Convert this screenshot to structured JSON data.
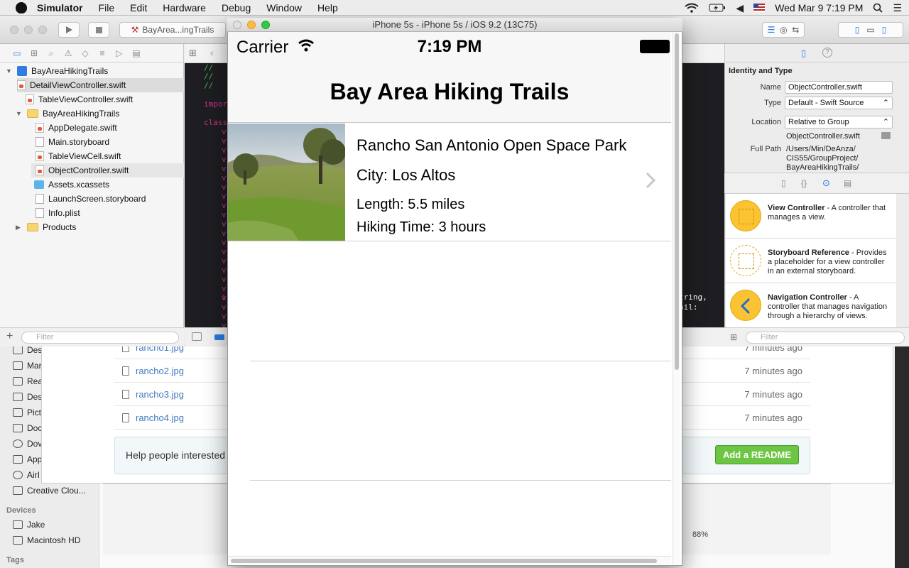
{
  "menubar": {
    "app": "Simulator",
    "items": [
      "File",
      "Edit",
      "Hardware",
      "Debug",
      "Window",
      "Help"
    ],
    "clock": "Wed Mar 9  7:19 PM"
  },
  "xcode": {
    "scheme": "BayArea...ingTrails",
    "navigator": {
      "items": [
        {
          "label": "BayAreaHikingTrails",
          "type": "project"
        },
        {
          "label": "DetailViewController.swift",
          "type": "swift"
        },
        {
          "label": "TableViewController.swift",
          "type": "swift"
        },
        {
          "label": "BayAreaHikingTrails",
          "type": "folder"
        },
        {
          "label": "AppDelegate.swift",
          "type": "swift"
        },
        {
          "label": "Main.storyboard",
          "type": "doc"
        },
        {
          "label": "TableViewCell.swift",
          "type": "swift"
        },
        {
          "label": "ObjectController.swift",
          "type": "swift"
        },
        {
          "label": "Assets.xcassets",
          "type": "assets"
        },
        {
          "label": "LaunchScreen.storyboard",
          "type": "doc"
        },
        {
          "label": "Info.plist",
          "type": "doc"
        },
        {
          "label": "Products",
          "type": "folder"
        }
      ],
      "filter_placeholder": "Filter"
    },
    "editor": {
      "c1": "//",
      "c2": "//",
      "c3": "//",
      "import": "impor",
      "class": "class",
      "i": "i",
      "right1": "tring,",
      "right2": "ail:"
    },
    "inspector": {
      "section": "Identity and Type",
      "name_label": "Name",
      "name_value": "ObjectController.swift",
      "type_label": "Type",
      "type_value": "Default - Swift Source",
      "location_label": "Location",
      "location_value": "Relative to Group",
      "location_file": "ObjectController.swift",
      "fullpath_label": "Full Path",
      "fullpath_value": "/Users/Min/DeAnza/\nCIS55/GroupProject/\nBayAreaHikingTrails/",
      "library": [
        {
          "title": "View Controller",
          "desc": " - A controller that manages a view."
        },
        {
          "title": "Storyboard Reference",
          "desc": " - Provides a placeholder for a view controller in an external storyboard."
        },
        {
          "title": "Navigation Controller",
          "desc": " - A controller that manages navigation through a hierarchy of views."
        }
      ],
      "filter_placeholder": "Filter"
    }
  },
  "finder": {
    "sidebar": [
      "Des",
      "Mar",
      "Rea",
      "Des",
      "Pict",
      "Doc",
      "Dov",
      "App",
      "AirI",
      "Creative Clou..."
    ],
    "devices_header": "Devices",
    "devices": [
      "Jake",
      "Macintosh HD"
    ],
    "tags_header": "Tags"
  },
  "github": {
    "files": [
      {
        "name": "rancho1.jpg",
        "time": "7 minutes ago"
      },
      {
        "name": "rancho2.jpg",
        "time": "7 minutes ago"
      },
      {
        "name": "rancho3.jpg",
        "time": "7 minutes ago"
      },
      {
        "name": "rancho4.jpg",
        "time": "7 minutes ago"
      }
    ],
    "readme_text": "Help people interested",
    "readme_button": "Add a README"
  },
  "ib": {
    "zoom": "88%"
  },
  "simulator": {
    "title": "iPhone 5s - iPhone 5s / iOS 9.2 (13C75)",
    "carrier": "Carrier",
    "time": "7:19 PM",
    "nav_title": "Bay Area Hiking Trails",
    "cell": {
      "name": "Rancho San Antonio Open Space Park",
      "city": "City: Los Altos",
      "length": "Length: 5.5 miles",
      "hiking_time": "Hiking Time: 3 hours"
    }
  }
}
